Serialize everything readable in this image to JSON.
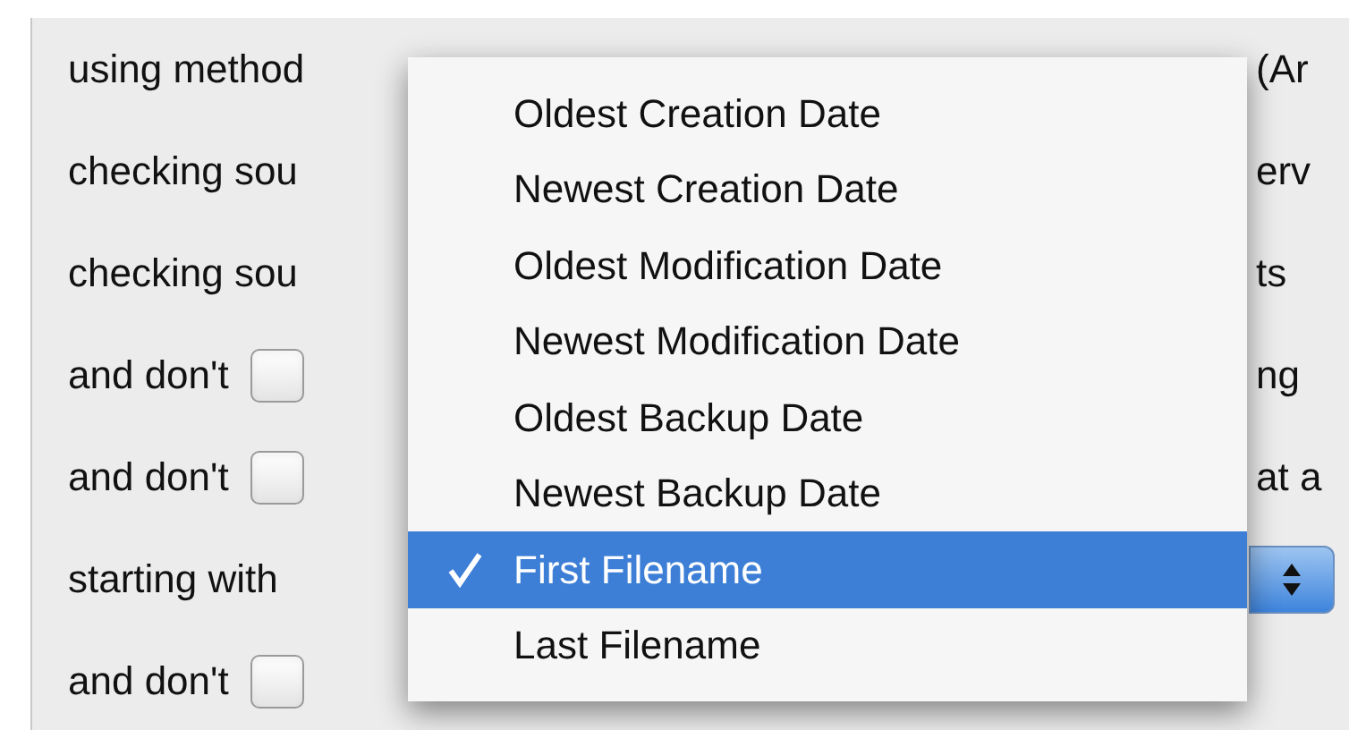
{
  "rows": [
    {
      "kind": "text",
      "label": "using method",
      "trailing": "(Ar"
    },
    {
      "kind": "text",
      "label": "checking sou",
      "trailing": "erv"
    },
    {
      "kind": "text",
      "label": "checking sou",
      "trailing": "ts"
    },
    {
      "kind": "checkbox",
      "label": "and don't",
      "checked": false,
      "trailing": "ng"
    },
    {
      "kind": "checkbox",
      "label": "and don't",
      "checked": false,
      "trailing": "at a"
    },
    {
      "kind": "popup",
      "label": "starting with"
    },
    {
      "kind": "checkbox",
      "label": "and don't",
      "checked": false
    }
  ],
  "menu": {
    "items": [
      {
        "label": "Oldest Creation Date",
        "selected": false
      },
      {
        "label": "Newest Creation Date",
        "selected": false
      },
      {
        "label": "Oldest Modification Date",
        "selected": false
      },
      {
        "label": "Newest Modification Date",
        "selected": false
      },
      {
        "label": "Oldest Backup Date",
        "selected": false
      },
      {
        "label": "Newest Backup Date",
        "selected": false
      },
      {
        "label": "First Filename",
        "selected": true
      },
      {
        "label": "Last Filename",
        "selected": false
      }
    ]
  }
}
